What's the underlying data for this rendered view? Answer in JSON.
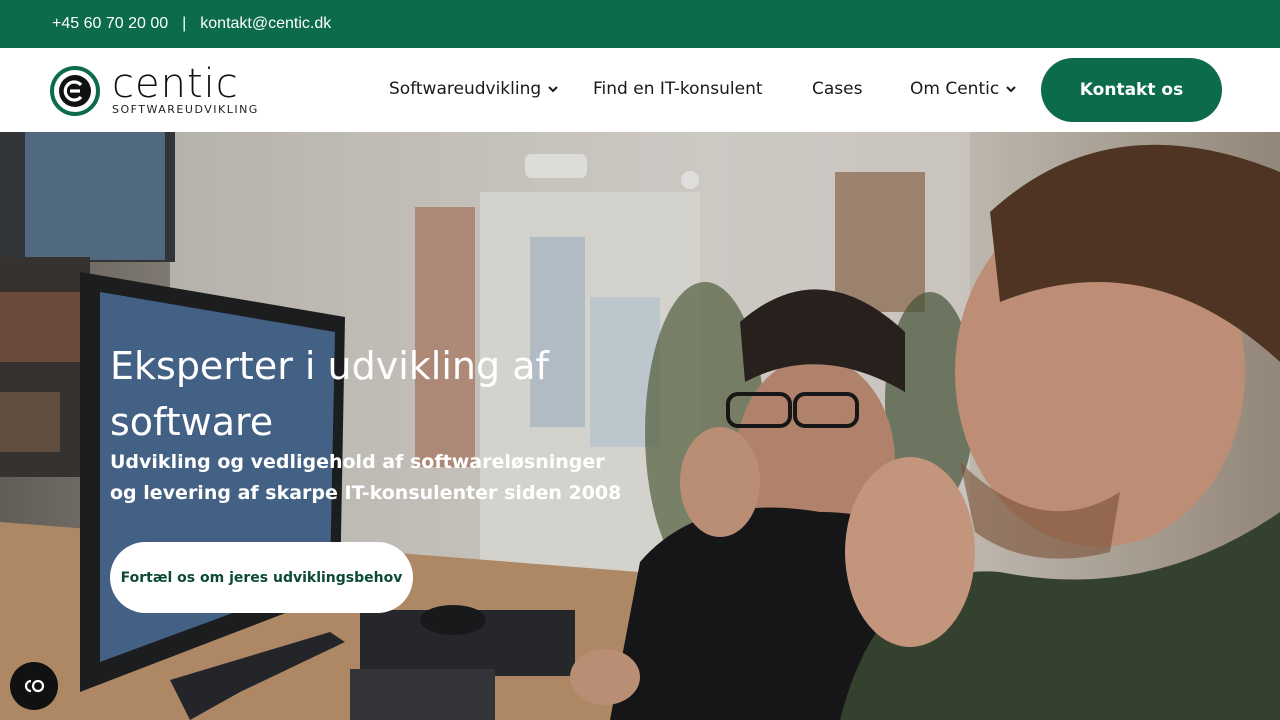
{
  "topbar": {
    "phone": "+45 60 70 20 00",
    "separator": "|",
    "email": "kontakt@centic.dk"
  },
  "logo": {
    "word": "centic",
    "tagline": "SOFTWAREUDVIKLING"
  },
  "nav": {
    "items": [
      {
        "label": "Softwareudvikling",
        "has_dropdown": true
      },
      {
        "label": "Find en IT-konsulent",
        "has_dropdown": false
      },
      {
        "label": "Cases",
        "has_dropdown": false
      },
      {
        "label": "Om Centic",
        "has_dropdown": true
      }
    ],
    "cta": "Kontakt os"
  },
  "hero": {
    "title": "Eksperter i udvikling af software",
    "subtitle": "Udvikling og vedligehold af softwareløsninger og levering af skarpe IT-konsulenter siden 2008",
    "button": "Fortæl os om jeres udviklingsbehov"
  },
  "colors": {
    "brand_green": "#0b6b4a",
    "white": "#ffffff"
  },
  "icons": {
    "cookie": "cookie-settings-icon",
    "chevron": "chevron-down-icon"
  }
}
